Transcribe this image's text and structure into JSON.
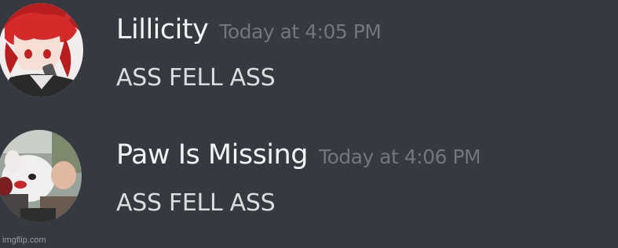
{
  "messages": [
    {
      "username": "Lillicity",
      "timestamp": "Today at 4:05 PM",
      "content": "ASS FELL ASS"
    },
    {
      "username": "Paw Is Missing",
      "timestamp": "Today at 4:06 PM",
      "content": "ASS FELL ASS"
    }
  ],
  "watermark": "imgflip.com",
  "colors": {
    "background": "#36393f",
    "username": "#f2f3f5",
    "timestamp": "#72767d",
    "content": "#dcddde"
  }
}
